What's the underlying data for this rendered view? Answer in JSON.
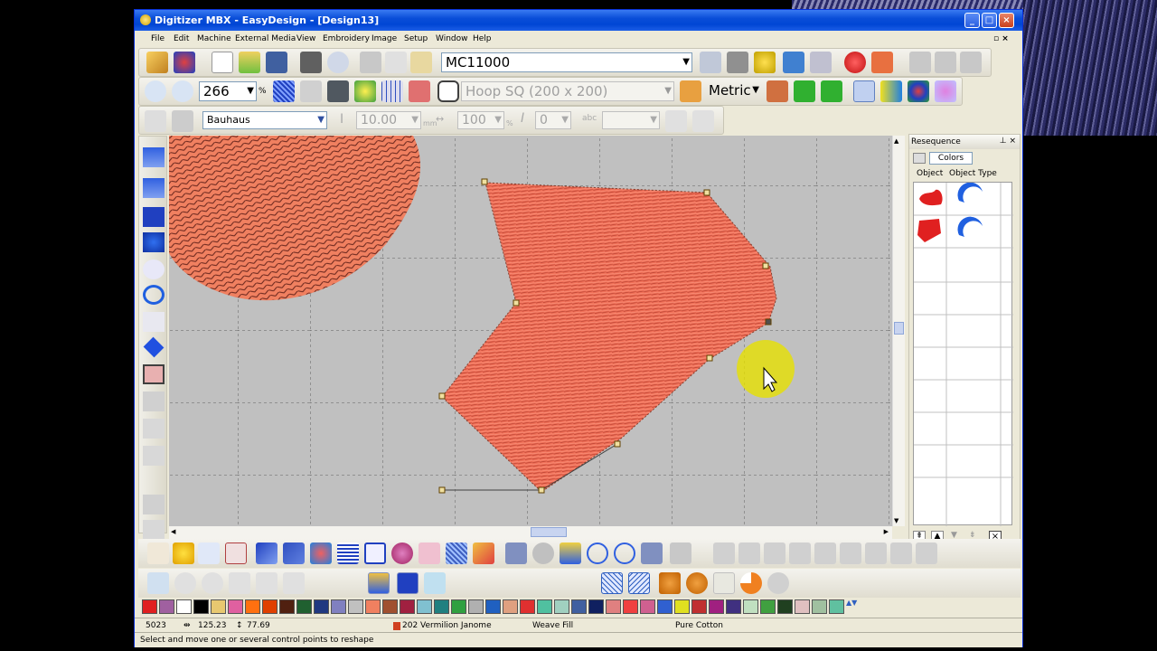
{
  "window": {
    "title": "Digitizer MBX - EasyDesign - [Design13]",
    "minimize_glyph": "_",
    "maximize_glyph": "□",
    "close_glyph": "×"
  },
  "menu": [
    "File",
    "Edit",
    "Machine",
    "External Media",
    "View",
    "Embroidery",
    "Image",
    "Setup",
    "Window",
    "Help"
  ],
  "toolbar1": {
    "machine": "MC11000"
  },
  "toolbar2": {
    "zoom": "266",
    "zoom_unit": "%",
    "hoop": "Hoop SQ (200 x 200)",
    "units": "Metric"
  },
  "toolbar3": {
    "font": "Bauhaus",
    "height": "10.00",
    "height_unit": "mm",
    "width": "100",
    "width_unit": "%",
    "slant": "0"
  },
  "panel": {
    "title": "Resequence",
    "colors_button": "Colors",
    "col_object": "Object",
    "col_type": "Object Type"
  },
  "status": {
    "stitch_count": "5023",
    "width": "125.23",
    "height": "77.69",
    "thread": "202 Vermilion Janome",
    "fill": "Weave Fill",
    "material": "Pure Cotton",
    "message": "Select and move one or several control points to reshape"
  },
  "colors": {
    "fill": "#f07058",
    "accent": "#0a4ed8",
    "cursor_highlight": "#e6e000"
  },
  "palette": [
    "#e02020",
    "#a060a0",
    "#ffffff",
    "#000000",
    "#e8c870",
    "#e060a0",
    "#ff7010",
    "#e04000",
    "#502010",
    "#206030",
    "#203880",
    "#8080c0",
    "#c0c0c0",
    "#f08060",
    "#a05030",
    "#a02040",
    "#80c0d0",
    "#208080",
    "#30a040",
    "#b0b0b0",
    "#2060c0",
    "#e0a080",
    "#e03030",
    "#50c0a0",
    "#a0d0c0",
    "#4060a0",
    "#102060",
    "#e08080",
    "#f04040",
    "#d06090",
    "#3060d0",
    "#e0e020",
    "#c03030",
    "#a02080",
    "#403080",
    "#c0e0c0",
    "#40a040",
    "#204020",
    "#e0c0c0",
    "#a0c0a0",
    "#60c0a0"
  ]
}
